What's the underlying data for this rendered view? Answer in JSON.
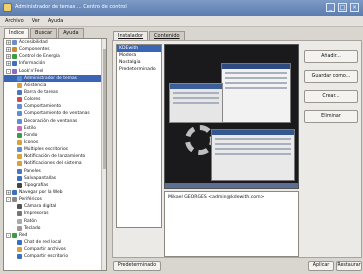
{
  "window": {
    "title": "Administrador de temas ... Centro de control"
  },
  "menubar": {
    "items": [
      "Archivo",
      "Ver",
      "Ayuda"
    ]
  },
  "left_tabs": [
    "Índice",
    "Buscar",
    "Ayuda"
  ],
  "tree": [
    {
      "label": "Accesibilidad",
      "level": 0,
      "expander": "+",
      "color": "#6a8fcf"
    },
    {
      "label": "Componentes",
      "level": 0,
      "expander": "+",
      "color": "#c98a3a"
    },
    {
      "label": "Control de Energía",
      "level": 0,
      "expander": "+",
      "color": "#3f9b3f"
    },
    {
      "label": "Información",
      "level": 0,
      "expander": "+",
      "color": "#3a70c0"
    },
    {
      "label": "Look'n'Feel",
      "level": 0,
      "expander": "-",
      "color": "#8a6dc0"
    },
    {
      "label": "Administrador de temas",
      "level": 1,
      "expander": "",
      "color": "#5b8fd6",
      "selected": true
    },
    {
      "label": "Asistencia",
      "level": 1,
      "expander": "",
      "color": "#d6a23b"
    },
    {
      "label": "Barra de tareas",
      "level": 1,
      "expander": "",
      "color": "#4b76b8"
    },
    {
      "label": "Colores",
      "level": 1,
      "expander": "",
      "color": "#d24b4b"
    },
    {
      "label": "Comportamiento",
      "level": 1,
      "expander": "",
      "color": "#5b8fd6"
    },
    {
      "label": "Comportamiento de ventanas",
      "level": 1,
      "expander": "",
      "color": "#5b8fd6"
    },
    {
      "label": "Decoración de ventanas",
      "level": 1,
      "expander": "",
      "color": "#5b8fd6"
    },
    {
      "label": "Estilo",
      "level": 1,
      "expander": "",
      "color": "#c96ab8"
    },
    {
      "label": "Fondo",
      "level": 1,
      "expander": "",
      "color": "#3f9b3f"
    },
    {
      "label": "Iconos",
      "level": 1,
      "expander": "",
      "color": "#d6a23b"
    },
    {
      "label": "Múltiples escritorios",
      "level": 1,
      "expander": "",
      "color": "#5b8fd6"
    },
    {
      "label": "Notificación de lanzamiento",
      "level": 1,
      "expander": "",
      "color": "#d6a23b"
    },
    {
      "label": "Notificaciones del sistema",
      "level": 1,
      "expander": "",
      "color": "#d6a23b"
    },
    {
      "label": "Paneles",
      "level": 1,
      "expander": "",
      "color": "#4b76b8"
    },
    {
      "label": "Salvapantallas",
      "level": 1,
      "expander": "",
      "color": "#3a70c0"
    },
    {
      "label": "Tipografías",
      "level": 1,
      "expander": "",
      "color": "#444444"
    },
    {
      "label": "Navegar por la Web",
      "level": 0,
      "expander": "+",
      "color": "#3a70c0"
    },
    {
      "label": "Periféricos",
      "level": 0,
      "expander": "-",
      "color": "#888888"
    },
    {
      "label": "Cámara digital",
      "level": 1,
      "expander": "",
      "color": "#555555"
    },
    {
      "label": "Impresoras",
      "level": 1,
      "expander": "",
      "color": "#777777"
    },
    {
      "label": "Ratón",
      "level": 1,
      "expander": "",
      "color": "#aaaaaa"
    },
    {
      "label": "Teclado",
      "level": 1,
      "expander": "",
      "color": "#999999"
    },
    {
      "label": "Red",
      "level": 0,
      "expander": "-",
      "color": "#3f9b3f"
    },
    {
      "label": "Chat de red local",
      "level": 1,
      "expander": "",
      "color": "#3a70c0"
    },
    {
      "label": "Compartir archivos",
      "level": 1,
      "expander": "",
      "color": "#d6a23b"
    },
    {
      "label": "Compartir escritorio",
      "level": 1,
      "expander": "",
      "color": "#3a70c0"
    }
  ],
  "right_tabs": [
    "Instalador",
    "Contenido"
  ],
  "themes": [
    {
      "name": "KDEwith",
      "selected": true
    },
    {
      "name": "Modera",
      "selected": false
    },
    {
      "name": "Nostalgia",
      "selected": false
    },
    {
      "name": "Predeterminado",
      "selected": false
    }
  ],
  "author": "Mikael GEORGES <admin@kdewith.com>",
  "buttons": {
    "add": "Añadir...",
    "save": "Guardar como...",
    "create": "Crear...",
    "delete": "Eliminar"
  },
  "bottom": {
    "default": "Predeterminado",
    "apply": "Aplicar",
    "restore": "Restaurar"
  }
}
